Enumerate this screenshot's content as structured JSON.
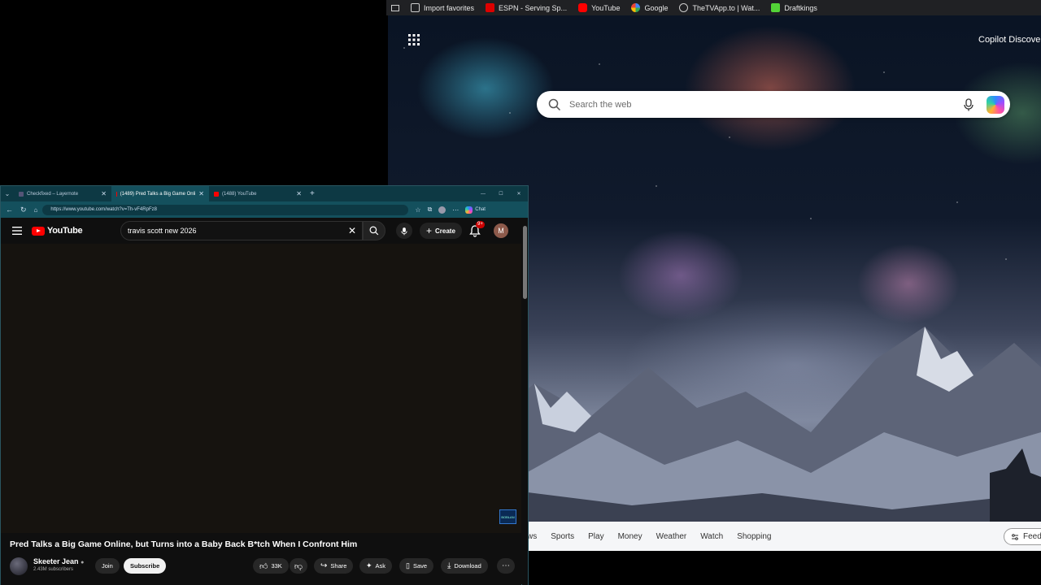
{
  "edge": {
    "bookmarks": [
      {
        "label": "Import favorites",
        "icon": "import-icon"
      },
      {
        "label": "ESPN - Serving Sp...",
        "icon": "espn-icon"
      },
      {
        "label": "YouTube",
        "icon": "youtube-icon"
      },
      {
        "label": "Google",
        "icon": "google-icon"
      },
      {
        "label": "TheTVApp.to | Wat...",
        "icon": "globe-icon"
      },
      {
        "label": "Draftkings",
        "icon": "draftkings-icon"
      }
    ],
    "copilot_discover": "Copilot Discove",
    "search_placeholder": "Search the web",
    "news_tabs": [
      "ws",
      "Sports",
      "Play",
      "Money",
      "Weather",
      "Watch",
      "Shopping"
    ],
    "feed_button": "Feed lay"
  },
  "yt_browser": {
    "tabs": [
      {
        "label": "Checkfixed – Layernote",
        "active": false
      },
      {
        "label": "(1489) Pred Talks a Big Game Onli",
        "active": true
      },
      {
        "label": "(1488) YouTube",
        "active": false
      }
    ],
    "url": "https://www.youtube.com/watch?v=Th-vF4RpFz8",
    "chat_label": "Chat"
  },
  "youtube": {
    "logo_text": "YouTube",
    "search_query": "travis scott new 2026",
    "create_label": "Create",
    "notification_count": "9+",
    "avatar_letter": "M",
    "watermark_text": "BOBLAN",
    "video_title": "Pred Talks a Big Game Online, but Turns into a Baby Back B*tch When I Confront Him",
    "channel_name": "Skeeter Jean",
    "subscribers": "2.43M subscribers",
    "join_label": "Join",
    "subscribe_label": "Subscribe",
    "like_count": "33K",
    "share_label": "Share",
    "ask_label": "Ask",
    "save_label": "Save",
    "download_label": "Download"
  },
  "colors": {
    "youtube_red": "#ff0000",
    "browser_teal": "#14505d",
    "player_bg": "#16130f"
  }
}
